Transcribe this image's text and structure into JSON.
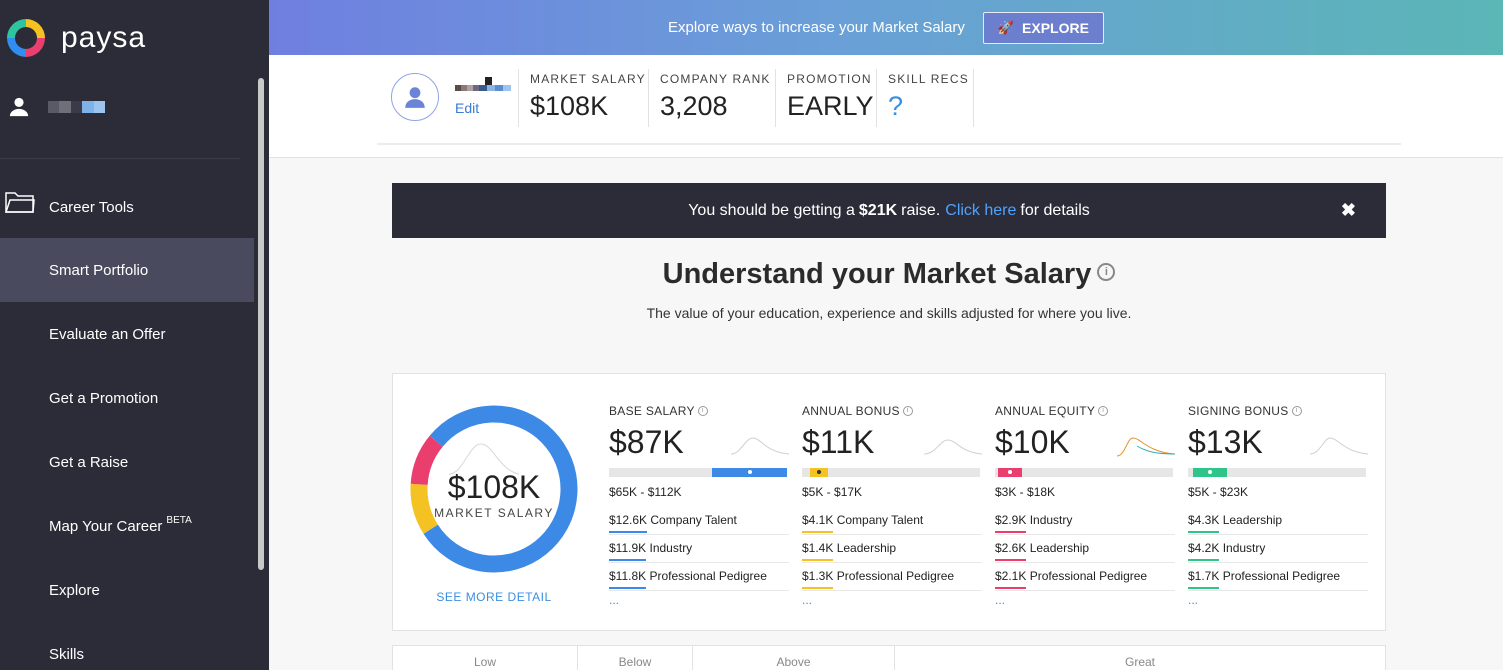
{
  "brand": {
    "name": "paysa"
  },
  "sidebar": {
    "section": "Career Tools",
    "items": [
      {
        "label": "Smart Portfolio",
        "active": true
      },
      {
        "label": "Evaluate an Offer"
      },
      {
        "label": "Get a Promotion"
      },
      {
        "label": "Get a Raise"
      },
      {
        "label": "Map Your Career",
        "badge": "BETA"
      },
      {
        "label": "Explore"
      },
      {
        "label": "Skills"
      }
    ]
  },
  "banner": {
    "text": "Explore ways to increase your Market Salary",
    "button": "EXPLORE"
  },
  "profile": {
    "edit": "Edit"
  },
  "stats": [
    {
      "label": "MARKET SALARY",
      "value": "$108K"
    },
    {
      "label": "COMPANY RANK",
      "value": "3,208"
    },
    {
      "label": "PROMOTION",
      "value": "EARLY"
    },
    {
      "label": "SKILL RECS",
      "value": "?"
    }
  ],
  "alert": {
    "pre": "You should be getting a",
    "amount": "$21K",
    "post": "raise.",
    "link": "Click here",
    "tail": "for details",
    "close": "✖"
  },
  "section": {
    "title": "Understand your Market Salary",
    "subtitle": "The value of your education, experience and skills adjusted for where you live."
  },
  "summary": {
    "value": "$108K",
    "label": "MARKET SALARY",
    "see_more": "SEE MORE DETAIL",
    "donut": [
      {
        "name": "base",
        "share": 0.8,
        "color": "#3d8ae6"
      },
      {
        "name": "bonus",
        "share": 0.1,
        "color": "#f5c223"
      },
      {
        "name": "equity",
        "share": 0.1,
        "color": "#ea3f6e"
      }
    ]
  },
  "components": [
    {
      "label": "BASE SALARY",
      "value": "$87K",
      "range": "$65K - $112K",
      "color": "#3d8ae6",
      "rows": [
        {
          "amt": "$12.6K",
          "text": "Company Talent"
        },
        {
          "amt": "$11.9K",
          "text": "Industry"
        },
        {
          "amt": "$11.8K",
          "text": "Professional Pedigree"
        }
      ],
      "more": "..."
    },
    {
      "label": "ANNUAL BONUS",
      "value": "$11K",
      "range": "$5K - $17K",
      "color": "#f5c223",
      "rows": [
        {
          "amt": "$4.1K",
          "text": "Company Talent"
        },
        {
          "amt": "$1.4K",
          "text": "Leadership"
        },
        {
          "amt": "$1.3K",
          "text": "Professional Pedigree"
        }
      ],
      "more": "..."
    },
    {
      "label": "ANNUAL EQUITY",
      "value": "$10K",
      "range": "$3K - $18K",
      "color": "#ea3f6e",
      "rows": [
        {
          "amt": "$2.9K",
          "text": "Industry"
        },
        {
          "amt": "$2.6K",
          "text": "Leadership"
        },
        {
          "amt": "$2.1K",
          "text": "Professional Pedigree"
        }
      ],
      "more": "..."
    },
    {
      "label": "SIGNING BONUS",
      "value": "$13K",
      "range": "$5K - $23K",
      "color": "#2ec48a",
      "rows": [
        {
          "amt": "$4.3K",
          "text": "Leadership"
        },
        {
          "amt": "$4.2K",
          "text": "Industry"
        },
        {
          "amt": "$1.7K",
          "text": "Professional Pedigree"
        }
      ],
      "more": "..."
    }
  ],
  "scale": [
    "Low",
    "Below",
    "Above",
    "Great"
  ]
}
